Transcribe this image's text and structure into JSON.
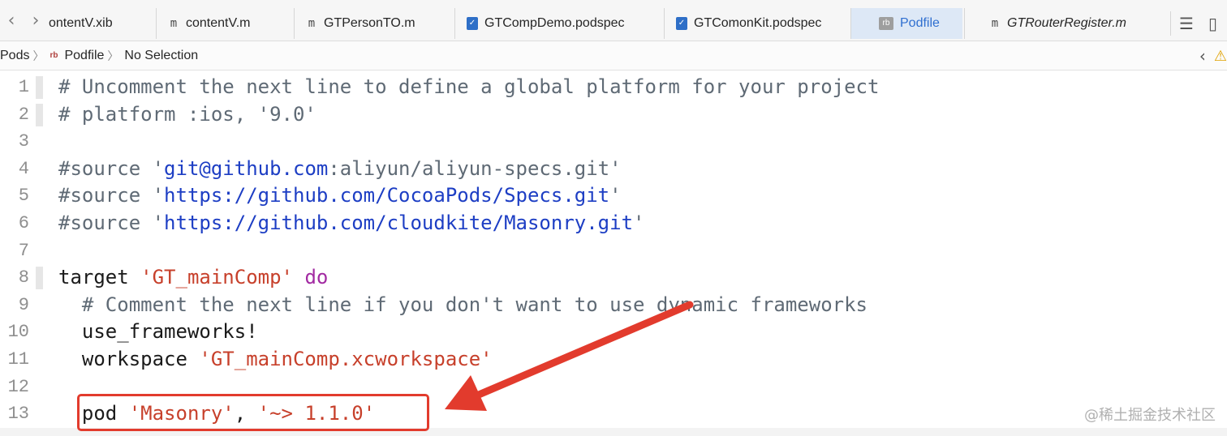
{
  "tabs": [
    {
      "label": "ontentV.xib",
      "icon": "xib-file-icon",
      "active": false,
      "italic": false
    },
    {
      "label": "contentV.m",
      "icon": "m-file-icon",
      "active": false,
      "italic": false
    },
    {
      "label": "GTPersonTO.m",
      "icon": "m-file-icon",
      "active": false,
      "italic": false
    },
    {
      "label": "GTCompDemo.podspec",
      "icon": "podspec-file-icon",
      "active": false,
      "italic": false
    },
    {
      "label": "GTComonKit.podspec",
      "icon": "podspec-file-icon",
      "active": false,
      "italic": false
    },
    {
      "label": "Podfile",
      "icon": "ruby-file-icon",
      "active": true,
      "italic": false
    },
    {
      "label": "GTRouterRegister.m",
      "icon": "m-file-icon",
      "active": false,
      "italic": true
    }
  ],
  "tab_icon_glyphs": {
    "m": "m",
    "rb": "rb"
  },
  "jumpbar": {
    "segment_1": "Pods",
    "segment_2_icon": "rb",
    "segment_2": "Podfile",
    "segment_3": "No Selection"
  },
  "editor": {
    "lines": [
      {
        "n": "1",
        "tokens": [
          {
            "t": "# Uncomment the next line to define a global platform for your project",
            "c": "tk-comment"
          }
        ]
      },
      {
        "n": "2",
        "tokens": [
          {
            "t": "# platform :ios, '9.0'",
            "c": "tk-comment"
          }
        ]
      },
      {
        "n": "3",
        "tokens": []
      },
      {
        "n": "4",
        "tokens": [
          {
            "t": "#source '",
            "c": "tk-comment"
          },
          {
            "t": "git@github.com",
            "c": "tk-url"
          },
          {
            "t": ":aliyun/aliyun-specs.git'",
            "c": "tk-comment"
          }
        ]
      },
      {
        "n": "5",
        "tokens": [
          {
            "t": "#source '",
            "c": "tk-comment"
          },
          {
            "t": "https://github.com/CocoaPods/Specs.git",
            "c": "tk-url"
          },
          {
            "t": "'",
            "c": "tk-comment"
          }
        ]
      },
      {
        "n": "6",
        "tokens": [
          {
            "t": "#source '",
            "c": "tk-comment"
          },
          {
            "t": "https://github.com/cloudkite/Masonry.git",
            "c": "tk-url"
          },
          {
            "t": "'",
            "c": "tk-comment"
          }
        ]
      },
      {
        "n": "7",
        "tokens": []
      },
      {
        "n": "8",
        "tokens": [
          {
            "t": "target ",
            "c": "tk-plain"
          },
          {
            "t": "'GT_mainComp'",
            "c": "tk-str"
          },
          {
            "t": " ",
            "c": "tk-plain"
          },
          {
            "t": "do",
            "c": "tk-kw"
          }
        ]
      },
      {
        "n": "9",
        "tokens": [
          {
            "t": "  # Comment the next line if you don't want to use dynamic frameworks",
            "c": "tk-comment"
          }
        ]
      },
      {
        "n": "10",
        "tokens": [
          {
            "t": "  use_frameworks!",
            "c": "tk-plain"
          }
        ]
      },
      {
        "n": "11",
        "tokens": [
          {
            "t": "  workspace ",
            "c": "tk-plain"
          },
          {
            "t": "'GT_mainComp.xcworkspace'",
            "c": "tk-str"
          }
        ]
      },
      {
        "n": "12",
        "tokens": []
      },
      {
        "n": "13",
        "tokens": [
          {
            "t": "  pod ",
            "c": "tk-plain"
          },
          {
            "t": "'Masonry'",
            "c": "tk-str"
          },
          {
            "t": ", ",
            "c": "tk-plain"
          },
          {
            "t": "'~> 1.1.0'",
            "c": "tk-str"
          }
        ]
      }
    ]
  },
  "watermark": "@稀土掘金技术社区",
  "colors": {
    "annotation_red": "#e23b2d",
    "active_tab_bg": "#dde8f6",
    "string_red": "#c7402b",
    "url_blue": "#1d3ec4",
    "keyword_purple": "#a22aa2"
  }
}
